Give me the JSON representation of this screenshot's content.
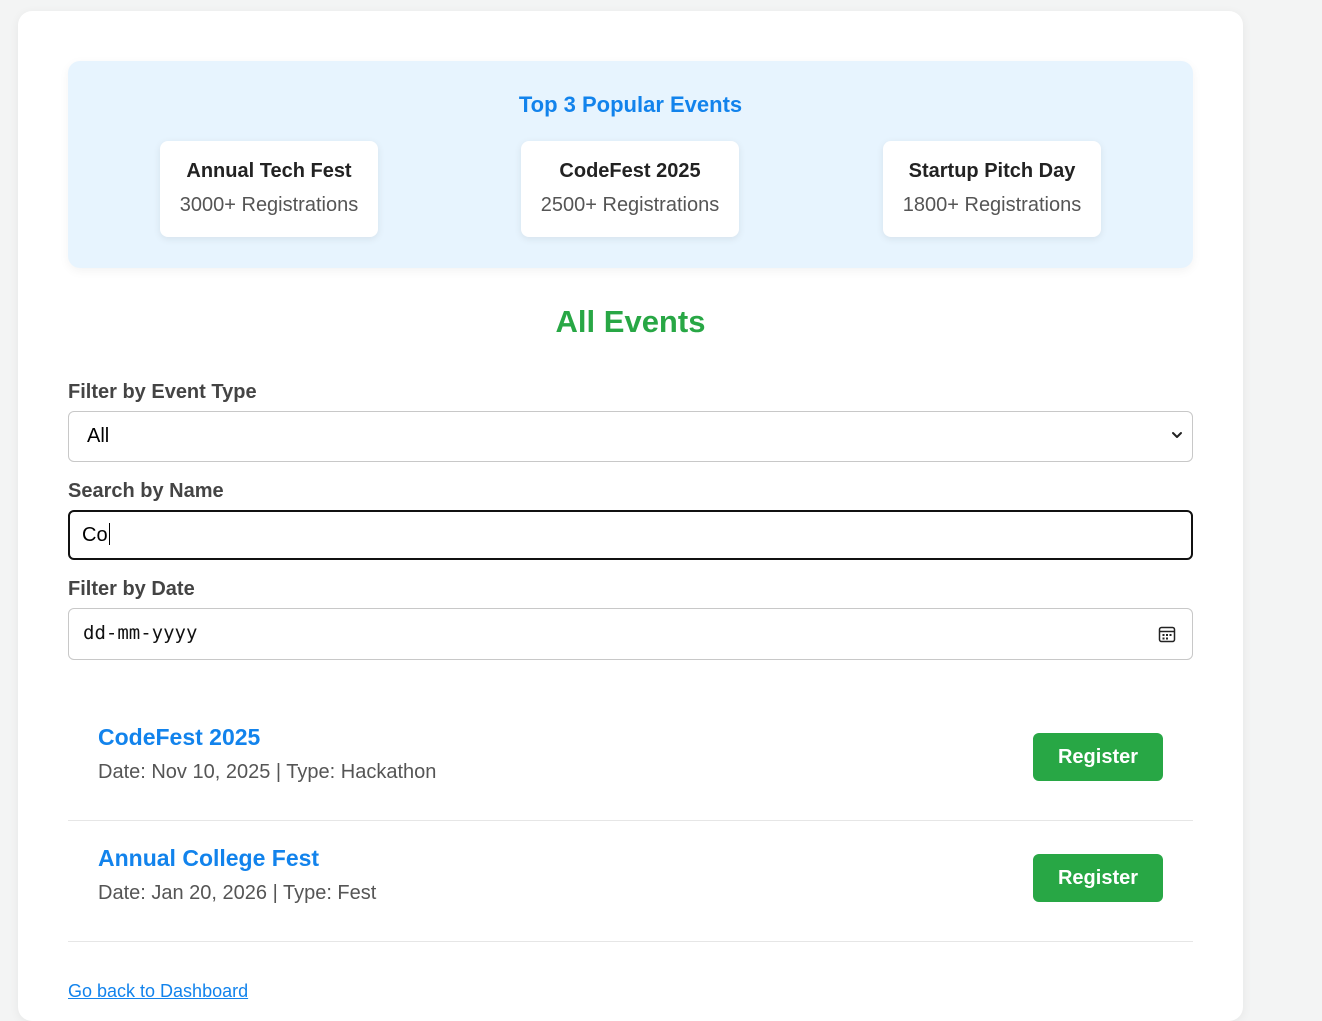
{
  "popular": {
    "title": "Top 3 Popular Events",
    "items": [
      {
        "name": "Annual Tech Fest",
        "registrations": "3000+ Registrations"
      },
      {
        "name": "CodeFest 2025",
        "registrations": "2500+ Registrations"
      },
      {
        "name": "Startup Pitch Day",
        "registrations": "1800+ Registrations"
      }
    ]
  },
  "all_events": {
    "heading": "All Events"
  },
  "filters": {
    "type_label": "Filter by Event Type",
    "type_value": "All",
    "search_label": "Search by Name",
    "search_value": "Co",
    "date_label": "Filter by Date",
    "date_placeholder": "dd-mm-yyyy"
  },
  "events": [
    {
      "name": "CodeFest 2025",
      "meta": "Date: Nov 10, 2025 | Type: Hackathon",
      "button": "Register"
    },
    {
      "name": "Annual College Fest",
      "meta": "Date: Jan 20, 2026 | Type: Fest",
      "button": "Register"
    }
  ],
  "footer": {
    "back_link": "Go back to Dashboard"
  },
  "colors": {
    "accent_blue": "#1283ec",
    "accent_green": "#28a745",
    "popular_bg": "#e7f4fe"
  },
  "icons": {
    "select": "chevron-down-icon",
    "date": "calendar-icon"
  }
}
